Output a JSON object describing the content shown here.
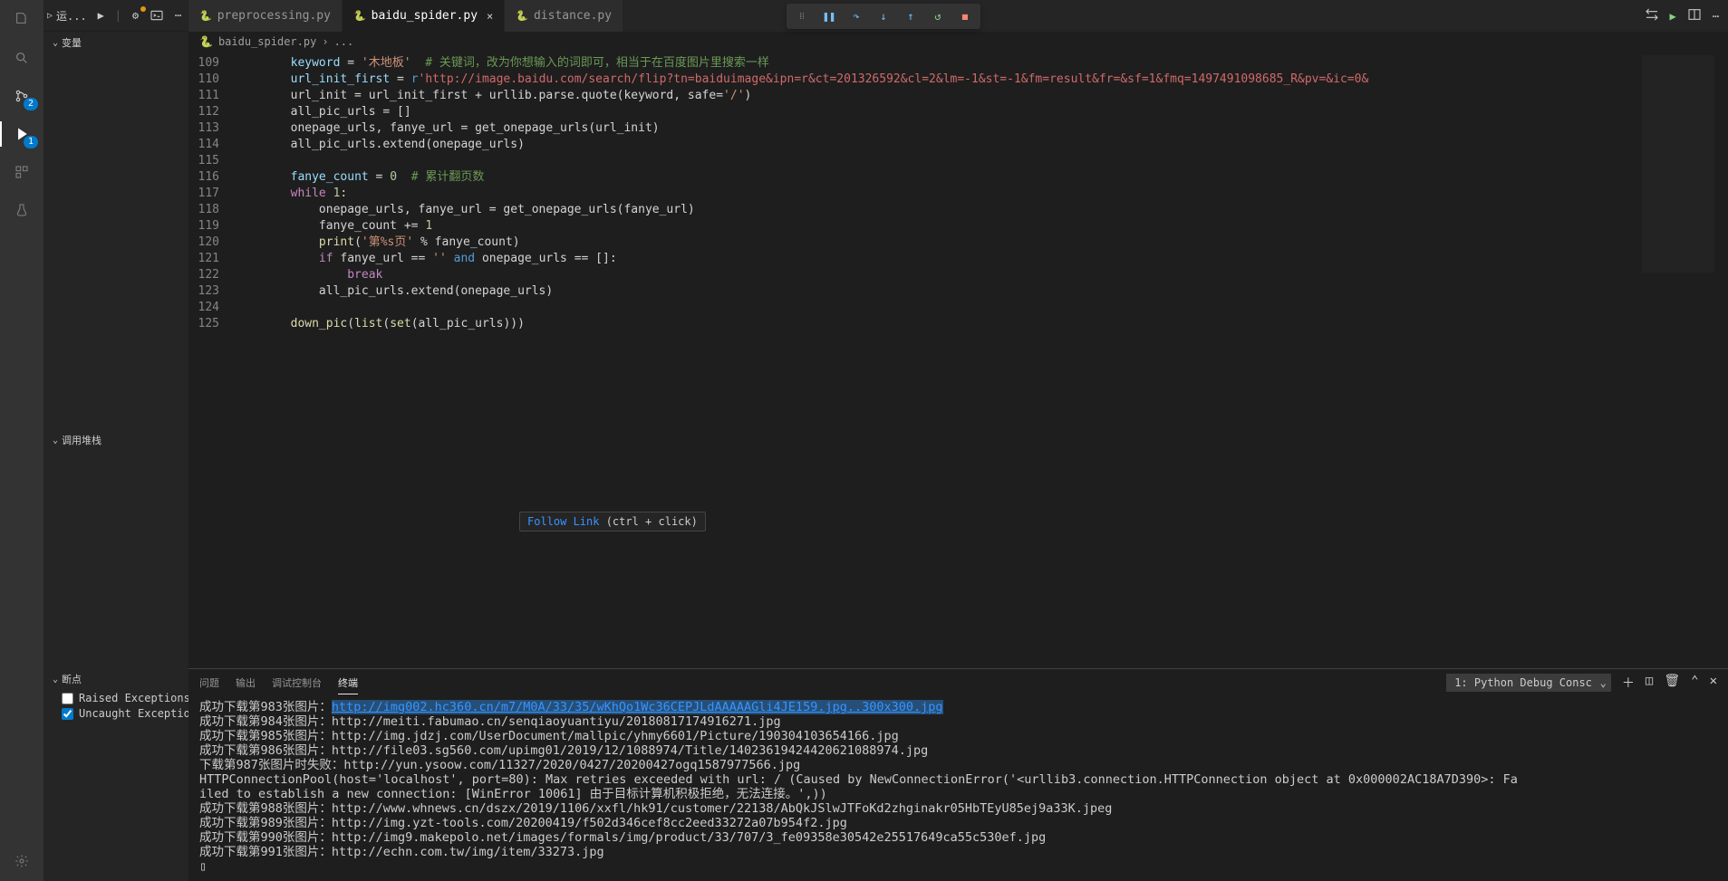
{
  "toolbar": {
    "run_label": "运..."
  },
  "sidebar": {
    "variables_label": "变量",
    "callstack_label": "调用堆栈",
    "breakpoints_label": "断点",
    "bp_raised": "Raised Exceptions",
    "bp_uncaught": "Uncaught Exceptio"
  },
  "tabs": [
    {
      "label": "preprocessing.py"
    },
    {
      "label": "baidu_spider.py"
    },
    {
      "label": "distance.py"
    }
  ],
  "breadcrumb": {
    "file": "baidu_spider.py",
    "rest": "..."
  },
  "debug_badge": "2",
  "run_badge": "1",
  "gutter": [
    "109",
    "110",
    "111",
    "112",
    "113",
    "114",
    "115",
    "116",
    "117",
    "118",
    "119",
    "120",
    "121",
    "122",
    "123",
    "124",
    "125"
  ],
  "code": {
    "l109_keyword_var": "keyword",
    "l109_keyword_val": "'木地板'",
    "l109_comment": "# 关键词，改为你想输入的词即可，相当于在百度图片里搜索一样",
    "l110_var": "url_init_first",
    "l110_url": "'http://image.baidu.com/search/flip?tn=baiduimage&ipn=r&ct=201326592&cl=2&lm=-1&st=-1&fm=result&fr=&sf=1&fmq=1497491098685_R&pv=&ic=0&",
    "l111": "url_init = url_init_first + urllib.parse.quote(keyword, safe=",
    "l111_safe": "'/'",
    "l112": "all_pic_urls = []",
    "l113": "onepage_urls, fanye_url = get_onepage_urls(url_init)",
    "l114": "all_pic_urls.extend(onepage_urls)",
    "l116_var": "fanye_count",
    "l116_num": "0",
    "l116_com": "# 累计翻页数",
    "l117_kw": "while",
    "l117_num": "1",
    "l118": "onepage_urls, fanye_url = get_onepage_urls(fanye_url)",
    "l119": "fanye_count += ",
    "l119_num": "1",
    "l120_fn": "print",
    "l120_str": "'第%s页'",
    "l120_rest": " % fanye_count)",
    "l121_if": "if",
    "l121_mid": " fanye_url == ",
    "l121_empty": "''",
    "l121_and": "and",
    "l121_rest": " onepage_urls == []:",
    "l122_break": "break",
    "l123": "all_pic_urls.extend(onepage_urls)",
    "l125_fn": "down_pic",
    "l125_list": "list",
    "l125_set": "set",
    "l125_rest": "(all_pic_urls)))"
  },
  "panel": {
    "tab_problems": "问题",
    "tab_output": "输出",
    "tab_debug": "调试控制台",
    "tab_terminal": "终端",
    "terminal_select": "1: Python Debug Consc"
  },
  "tooltip": {
    "label": "Follow Link",
    "hint": " (ctrl + click)"
  },
  "terminal_lines": [
    {
      "prefix": "成功下载第983张图片：",
      "link": "http://img002.hc360.cn/m7/M0A/33/35/wKhQo1Wc36CEPJLdAAAAAGli4JE159.jpg..300x300.jpg",
      "highlighted": true
    },
    {
      "prefix": "成功下载第984张图片：",
      "link": "http://meiti.fabumao.cn/senqiaoyuantiyu/20180817174916271.jpg"
    },
    {
      "prefix": "成功下载第985张图片：",
      "link": "http://img.jdzj.com/UserDocument/mallpic/yhmy6601/Picture/190304103654166.jpg"
    },
    {
      "prefix": "成功下载第986张图片：",
      "link": "http://file03.sg560.com/upimg01/2019/12/1088974/Title/14023619424420621088974.jpg"
    },
    {
      "prefix": "下载第987张图片时失败：",
      "link": "http://yun.ysoow.com/11327/2020/0427/20200427ogq1587977566.jpg"
    },
    {
      "raw": "HTTPConnectionPool(host='localhost', port=80): Max retries exceeded with url: / (Caused by NewConnectionError('<urllib3.connection.HTTPConnection object at 0x000002AC18A7D390>: Fa"
    },
    {
      "raw": "iled to establish a new connection: [WinError 10061] 由于目标计算机积极拒绝，无法连接。',))"
    },
    {
      "prefix": "成功下载第988张图片：",
      "link": "http://www.whnews.cn/dszx/2019/1106/xxfl/hk91/customer/22138/AbQkJSlwJTFoKd2zhginakr05HbTEyU85ej9a33K.jpeg"
    },
    {
      "prefix": "成功下载第989张图片：",
      "link": "http://img.yzt-tools.com/20200419/f502d346cef8cc2eed33272a07b954f2.jpg"
    },
    {
      "prefix": "成功下载第990张图片：",
      "link": "http://img9.makepolo.net/images/formals/img/product/33/707/3_fe09358e30542e25517649ca55c530ef.jpg"
    },
    {
      "prefix": "成功下载第991张图片：",
      "link": "http://echn.com.tw/img/item/33273.jpg"
    },
    {
      "raw": "▯"
    }
  ]
}
